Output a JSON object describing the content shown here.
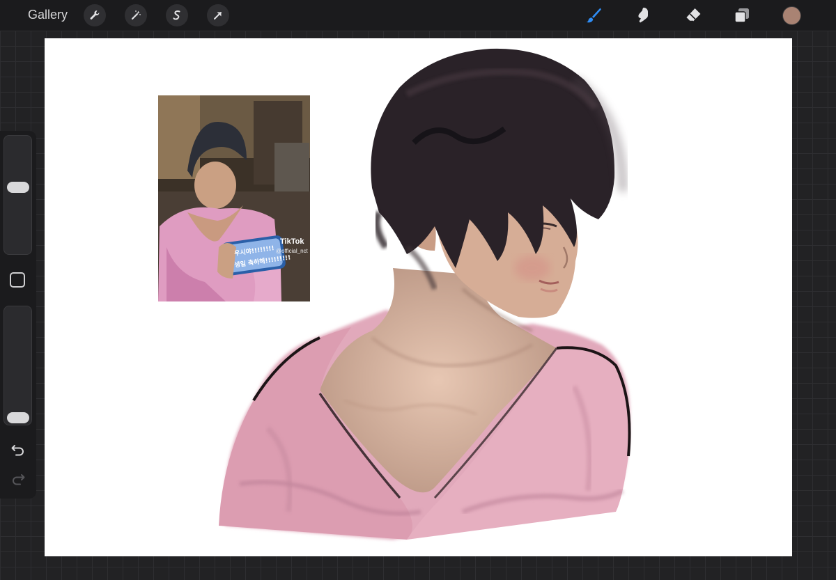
{
  "topbar": {
    "gallery_label": "Gallery",
    "left_tools": [
      "wrench-icon",
      "magic-wand-icon",
      "selection-icon",
      "transform-arrow-icon"
    ],
    "right_tools": [
      "brush-icon",
      "smudge-icon",
      "eraser-icon",
      "layers-icon"
    ],
    "active_tool": "brush-icon",
    "accent_color": "#2f8df5",
    "current_color": "#a98373"
  },
  "sidebar": {
    "brush_size_level": 0.58,
    "opacity_level": 0.0,
    "icons": [
      "modifier-square-icon",
      "undo-icon",
      "redo-icon"
    ]
  },
  "reference_photo": {
    "watermark_app": "TikTok",
    "watermark_user": "@official_nct",
    "phone_line1": "우시야!!!!!!!!",
    "phone_line2": "생일 축하해!!!!!!!!!"
  }
}
